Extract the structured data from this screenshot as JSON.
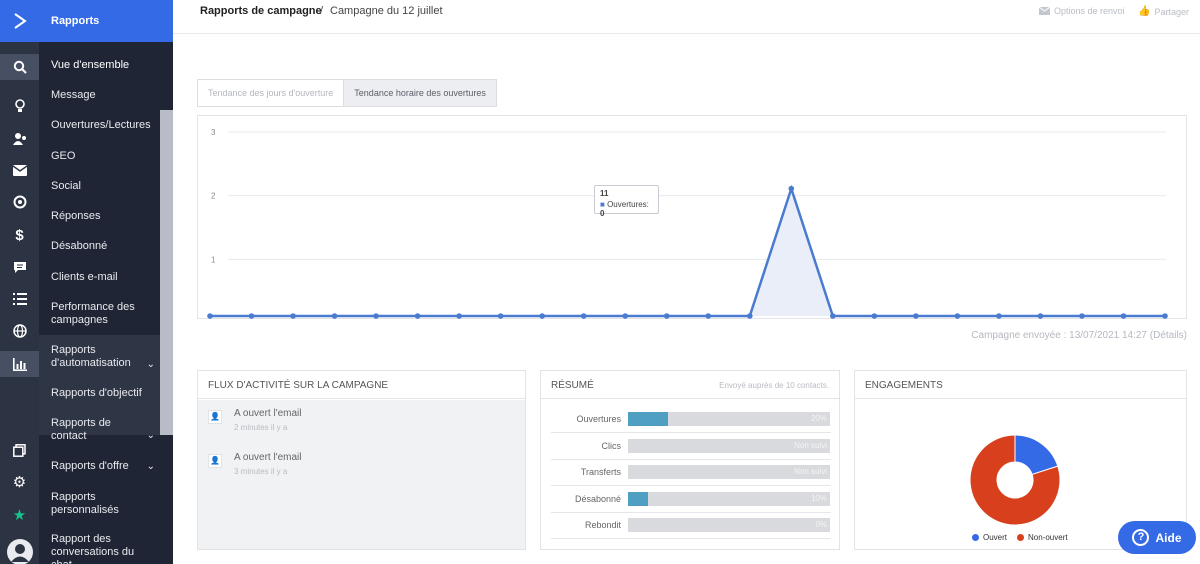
{
  "rail": {
    "colors": {
      "background": "#2c3343",
      "brand": "#356ae6",
      "active": "#475063"
    },
    "icons": [
      "search-icon",
      "lightbulb-icon",
      "contacts-icon",
      "envelope-icon",
      "target-icon",
      "dollar-icon",
      "chat-icon",
      "list-icon",
      "globe-icon",
      "bar-chart-icon",
      "windows-icon",
      "gear-icon",
      "star-icon",
      "avatar-icon"
    ]
  },
  "nav": {
    "title": "Rapports",
    "items": [
      {
        "label": "Vue d'ensemble"
      },
      {
        "label": "Message"
      },
      {
        "label": "Ouvertures/Lectures"
      },
      {
        "label": "GEO"
      },
      {
        "label": "Social"
      },
      {
        "label": "Réponses"
      },
      {
        "label": "Désabonné"
      },
      {
        "label": "Clients e-mail"
      },
      {
        "label": "Performance des campagnes"
      },
      {
        "label": "Rapports d'automatisation"
      },
      {
        "label": "Rapports d'objectif"
      },
      {
        "label": "Rapports de contact"
      },
      {
        "label": "Rapports d'offre"
      },
      {
        "label": "Rapports personnalisés"
      },
      {
        "label": "Rapport des conversations du chat"
      }
    ]
  },
  "header": {
    "crumb_main": "Rapports de campagne",
    "crumb_sep": "/",
    "crumb_sub": "Campagne du 12 juillet",
    "action_options": "Options de renvoi",
    "action_share": "Partager"
  },
  "tabs": [
    {
      "label": "Tendance des jours d'ouverture"
    },
    {
      "label": "Tendance horaire des ouvertures"
    }
  ],
  "tooltip": {
    "title": "11",
    "series": "Ouvertures:",
    "value": "0"
  },
  "chart_data": {
    "type": "area",
    "y_ticks": [
      "1",
      "2",
      "3"
    ],
    "ylim": [
      0,
      3
    ],
    "x": [
      0,
      1,
      2,
      3,
      4,
      5,
      6,
      7,
      8,
      9,
      10,
      11,
      12,
      13,
      14,
      15,
      16,
      17,
      18,
      19,
      20,
      21,
      22,
      23
    ],
    "series": [
      {
        "name": "Ouvertures",
        "values": [
          0,
          0,
          0,
          0,
          0,
          0,
          0,
          0,
          0,
          0,
          0,
          0,
          0,
          0,
          2,
          0,
          0,
          0,
          0,
          0,
          0,
          0,
          0,
          0
        ],
        "color": "#4a7bd0"
      }
    ],
    "grid": true
  },
  "chart_footer": "Campagne envoyée : 13/07/2021 14:27 (Détails)",
  "flux": {
    "title": "FLUX D'ACTIVITÉ SUR LA CAMPAGNE",
    "items": [
      {
        "text": "A ouvert l'email",
        "meta": "2 minutes il y a"
      },
      {
        "text": "A ouvert l'email",
        "meta": "3 minutes il y a"
      }
    ]
  },
  "resume": {
    "title": "RÉSUMÉ",
    "subtitle": "Envoyé auprès de 10 contacts.",
    "rows": [
      {
        "label": "Ouvertures",
        "value": "20%",
        "fill": 0.2
      },
      {
        "label": "Clics",
        "value": "Non suivi",
        "fill": 0
      },
      {
        "label": "Transferts",
        "value": "Non suivi",
        "fill": 0
      },
      {
        "label": "Désabonné",
        "value": "10%",
        "fill": 0.1
      },
      {
        "label": "Rebondit",
        "value": "0%",
        "fill": 0
      }
    ]
  },
  "engagements": {
    "title": "ENGAGEMENTS",
    "chart_data": {
      "type": "pie",
      "slices": [
        {
          "name": "Ouvert",
          "value": 20,
          "color": "#356ae6"
        },
        {
          "name": "Non-ouvert",
          "value": 80,
          "color": "#d8401d"
        }
      ]
    },
    "legend": [
      {
        "name": "Ouvert",
        "color": "#356ae6"
      },
      {
        "name": "Non-ouvert",
        "color": "#d8401d"
      }
    ]
  },
  "aide": {
    "label": "Aide"
  }
}
